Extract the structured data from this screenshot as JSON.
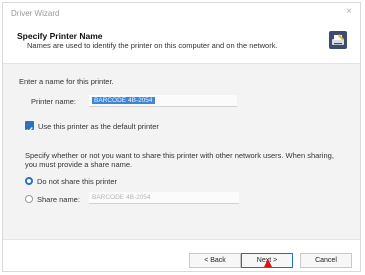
{
  "window": {
    "title": "Driver Wizard",
    "close_glyph": "×"
  },
  "header": {
    "title": "Specify Printer Name",
    "subtitle": "Names are used to identify the printer on this computer and on the network.",
    "icon": "printer-wizard-icon"
  },
  "form": {
    "intro": "Enter a name for this printer.",
    "printer_name_label": "Printer name:",
    "printer_name_value": "BARCODE 4B-2054",
    "default_checkbox_label": "Use this printer as the default printer",
    "default_checked": true,
    "share_intro_line1": "Specify whether or not you want to share this printer with other network users.  When sharing,",
    "share_intro_line2": "you must provide a share name.",
    "radio_no_share_label": "Do not share this printer",
    "radio_share_label": "Share name:",
    "share_name_value": "BARCODE 4B-2054",
    "selected_option": "Do not share this printer"
  },
  "footer": {
    "back_label": "< Back",
    "next_label": "Next >",
    "cancel_label": "Cancel"
  },
  "colors": {
    "accent": "#2f6fc2",
    "selection": "#3b86d9"
  }
}
